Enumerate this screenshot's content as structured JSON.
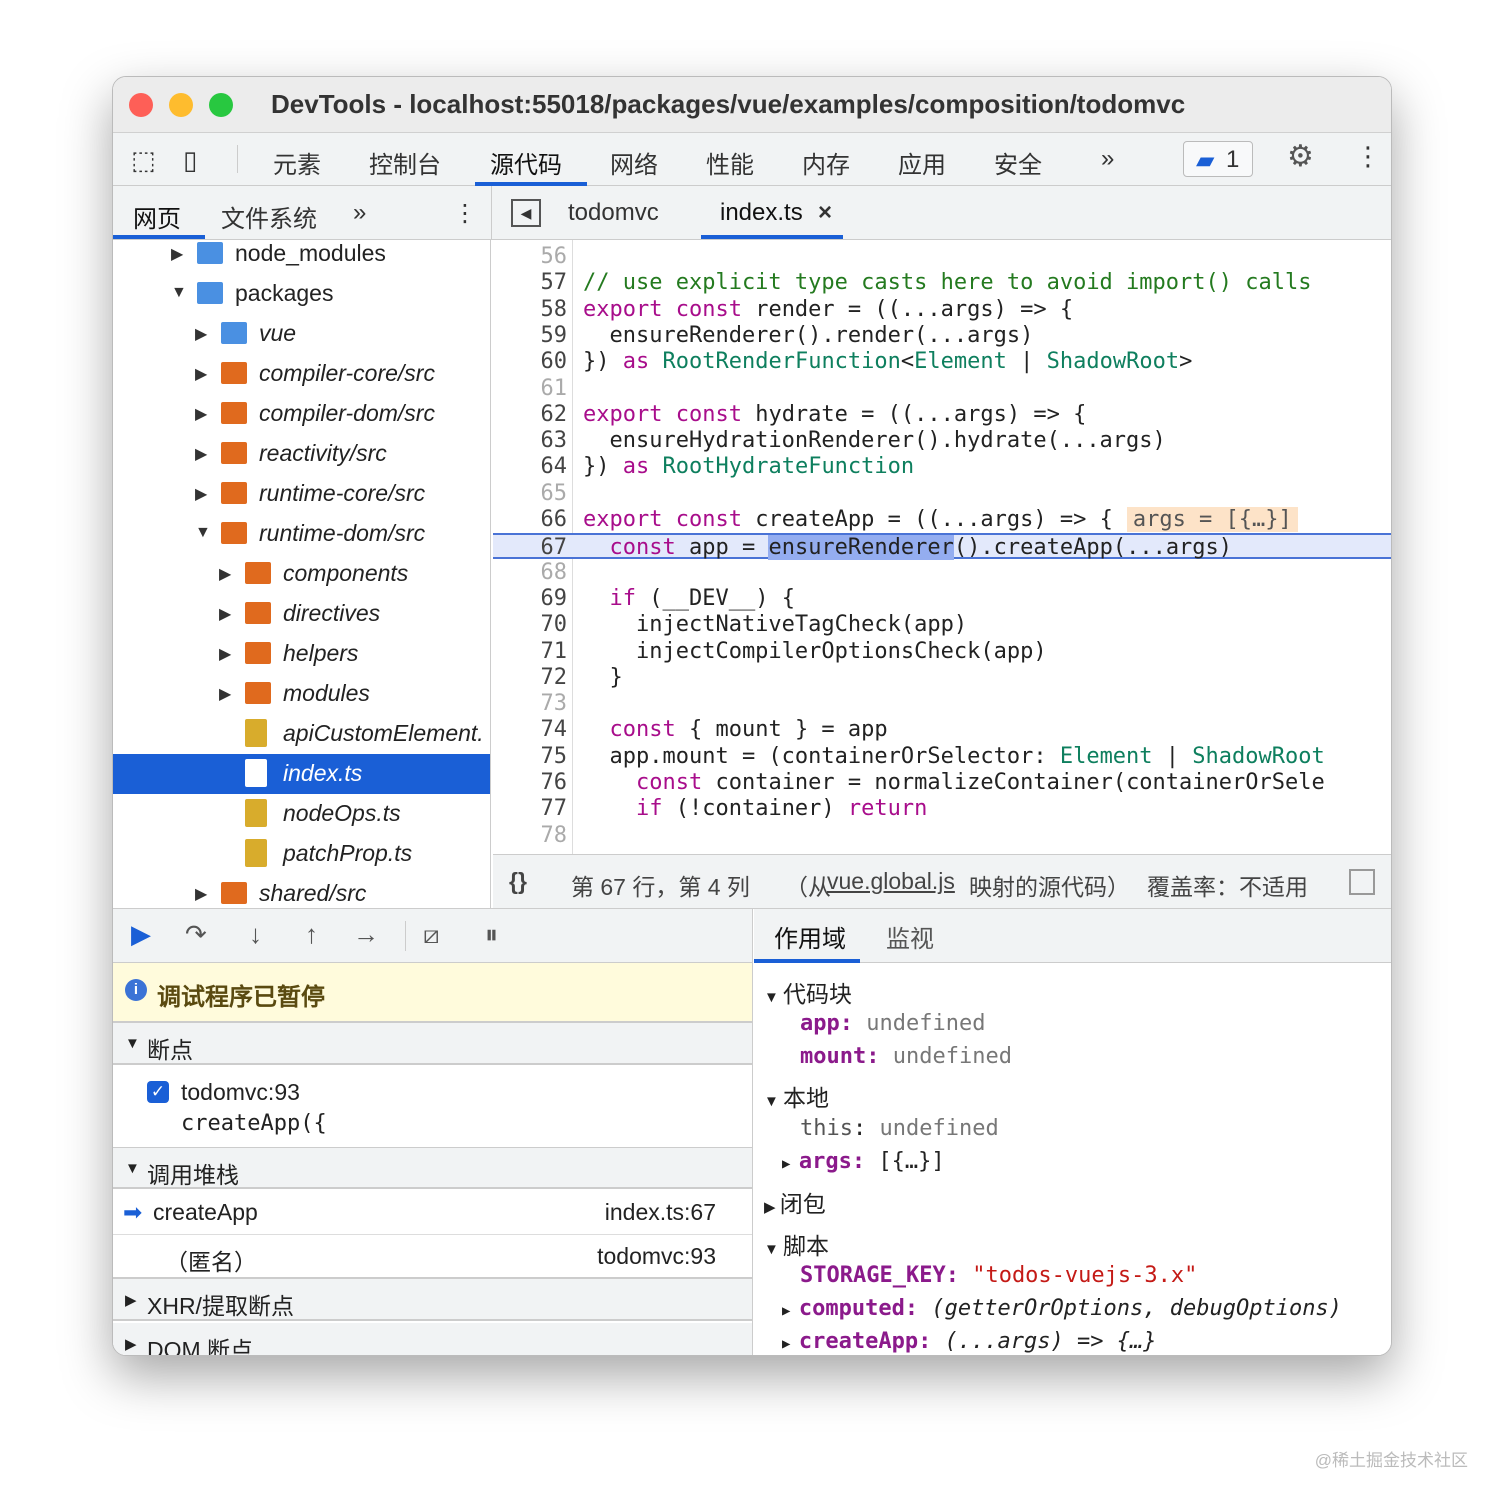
{
  "window": {
    "title": "DevTools - localhost:55018/packages/vue/examples/composition/todomvc"
  },
  "toolbar": {
    "tabs": [
      "元素",
      "控制台",
      "源代码",
      "网络",
      "性能",
      "内存",
      "应用",
      "安全"
    ],
    "active": "源代码",
    "more": "»",
    "issues_count": "1"
  },
  "navigator": {
    "tabs": [
      "网页",
      "文件系统"
    ],
    "more": "»",
    "active": "网页"
  },
  "editor_tabs": {
    "tabs": [
      "todomvc",
      "index.ts"
    ],
    "active": "index.ts",
    "close": "×"
  },
  "tree": [
    {
      "label": "node_modules",
      "depth": 0,
      "open": false,
      "type": "folder-blue"
    },
    {
      "label": "packages",
      "depth": 0,
      "open": true,
      "type": "folder-blue"
    },
    {
      "label": "vue",
      "depth": 1,
      "open": false,
      "type": "folder-blue"
    },
    {
      "label": "compiler-core/src",
      "depth": 1,
      "open": false,
      "type": "folder-orange"
    },
    {
      "label": "compiler-dom/src",
      "depth": 1,
      "open": false,
      "type": "folder-orange"
    },
    {
      "label": "reactivity/src",
      "depth": 1,
      "open": false,
      "type": "folder-orange"
    },
    {
      "label": "runtime-core/src",
      "depth": 1,
      "open": false,
      "type": "folder-orange"
    },
    {
      "label": "runtime-dom/src",
      "depth": 1,
      "open": true,
      "type": "folder-orange"
    },
    {
      "label": "components",
      "depth": 2,
      "open": false,
      "type": "folder-orange"
    },
    {
      "label": "directives",
      "depth": 2,
      "open": false,
      "type": "folder-orange"
    },
    {
      "label": "helpers",
      "depth": 2,
      "open": false,
      "type": "folder-orange"
    },
    {
      "label": "modules",
      "depth": 2,
      "open": false,
      "type": "folder-orange"
    },
    {
      "label": "apiCustomElement.",
      "depth": 2,
      "type": "file"
    },
    {
      "label": "index.ts",
      "depth": 2,
      "type": "file",
      "selected": true
    },
    {
      "label": "nodeOps.ts",
      "depth": 2,
      "type": "file"
    },
    {
      "label": "patchProp.ts",
      "depth": 2,
      "type": "file"
    },
    {
      "label": "shared/src",
      "depth": 1,
      "open": false,
      "type": "folder-orange"
    }
  ],
  "code": [
    {
      "n": "56",
      "t": []
    },
    {
      "n": "57",
      "t": [
        [
          "// use explicit type casts here to avoid import() calls",
          "cm"
        ]
      ]
    },
    {
      "n": "58",
      "t": [
        [
          "export const",
          "kw"
        ],
        [
          " render = ((...args) => {",
          ""
        ]
      ]
    },
    {
      "n": "59",
      "t": [
        [
          "  ensureRenderer().render(...args)",
          ""
        ]
      ]
    },
    {
      "n": "60",
      "t": [
        [
          "}) ",
          ""
        ],
        [
          "as",
          "kw"
        ],
        [
          " ",
          ""
        ],
        [
          "RootRenderFunction",
          "ty"
        ],
        [
          "<",
          ""
        ],
        [
          "Element",
          "ty"
        ],
        [
          " | ",
          ""
        ],
        [
          "ShadowRoot",
          "ty"
        ],
        [
          ">",
          ""
        ]
      ]
    },
    {
      "n": "61",
      "t": []
    },
    {
      "n": "62",
      "t": [
        [
          "export const",
          "kw"
        ],
        [
          " hydrate = ((...args) => {",
          ""
        ]
      ]
    },
    {
      "n": "63",
      "t": [
        [
          "  ensureHydrationRenderer().hydrate(...args)",
          ""
        ]
      ]
    },
    {
      "n": "64",
      "t": [
        [
          "}) ",
          ""
        ],
        [
          "as",
          "kw"
        ],
        [
          " ",
          ""
        ],
        [
          "RootHydrateFunction",
          "ty"
        ]
      ]
    },
    {
      "n": "65",
      "t": []
    },
    {
      "n": "66",
      "t": [
        [
          "export const",
          "kw"
        ],
        [
          " createApp = ((...args) => {",
          ""
        ],
        [
          "args = [{…}]",
          "inl"
        ]
      ]
    },
    {
      "n": "67",
      "t": [
        [
          "  ",
          ""
        ],
        [
          "const",
          "kw"
        ],
        [
          " app = ",
          ""
        ],
        [
          "ensureRenderer",
          "hl"
        ],
        [
          "().createApp(...args)",
          ""
        ]
      ],
      "current": true
    },
    {
      "n": "68",
      "t": []
    },
    {
      "n": "69",
      "t": [
        [
          "  ",
          ""
        ],
        [
          "if",
          "kw"
        ],
        [
          " (__DEV__) {",
          ""
        ]
      ]
    },
    {
      "n": "70",
      "t": [
        [
          "    injectNativeTagCheck(app)",
          ""
        ]
      ]
    },
    {
      "n": "71",
      "t": [
        [
          "    injectCompilerOptionsCheck(app)",
          ""
        ]
      ]
    },
    {
      "n": "72",
      "t": [
        [
          "  }",
          ""
        ]
      ]
    },
    {
      "n": "73",
      "t": []
    },
    {
      "n": "74",
      "t": [
        [
          "  ",
          ""
        ],
        [
          "const",
          "kw"
        ],
        [
          " { mount } = app",
          ""
        ]
      ]
    },
    {
      "n": "75",
      "t": [
        [
          "  app.mount = (containerOrSelector: ",
          ""
        ],
        [
          "Element",
          "ty"
        ],
        [
          " | ",
          ""
        ],
        [
          "ShadowRoot",
          "ty"
        ]
      ]
    },
    {
      "n": "76",
      "t": [
        [
          "    ",
          ""
        ],
        [
          "const",
          "kw"
        ],
        [
          " container = normalizeContainer(containerOrSele",
          ""
        ]
      ]
    },
    {
      "n": "77",
      "t": [
        [
          "    ",
          ""
        ],
        [
          "if",
          "kw"
        ],
        [
          " (!container) ",
          ""
        ],
        [
          "return",
          "kw"
        ]
      ]
    },
    {
      "n": "78",
      "t": []
    }
  ],
  "status": {
    "braces": "{}",
    "position": "第 67 行，第 4 列",
    "source_prefix": "（从",
    "source_link": "vue.global.js",
    "source_suffix": "映射的源代码）",
    "coverage": "覆盖率：不适用"
  },
  "debugger": {
    "paused_message": "调试程序已暂停",
    "breakpoints_title": "断点",
    "breakpoint": {
      "location": "todomvc:93",
      "code": "createApp({",
      "checked": true
    },
    "callstack_title": "调用堆栈",
    "frames": [
      {
        "name": "createApp",
        "loc": "index.ts:67",
        "current": true
      },
      {
        "name": "（匿名）",
        "loc": "todomvc:93"
      }
    ],
    "xhr_title": "XHR/提取断点",
    "dom_title": "DOM 断点"
  },
  "scope": {
    "tabs": [
      "作用域",
      "监视"
    ],
    "active": "作用域",
    "block_title": "代码块",
    "block": [
      {
        "k": "app",
        "v": "undefined"
      },
      {
        "k": "mount",
        "v": "undefined"
      }
    ],
    "local_title": "本地",
    "local_this_k": "this",
    "local_this_v": "undefined",
    "local_args_k": "args",
    "local_args_v": "[{…}]",
    "closure_title": "闭包",
    "script_title": "脚本",
    "script": [
      {
        "k": "STORAGE_KEY",
        "v": "\"todos-vuejs-3.x\""
      },
      {
        "k": "computed",
        "v": "(getterOrOptions, debugOptions)"
      },
      {
        "k": "createApp",
        "v": "(...args) => {…}"
      }
    ]
  },
  "watermark": "@稀土掘金技术社区",
  "colors": {
    "accent": "#1a5fd6",
    "keyword": "#a80d8b",
    "comment": "#247a1f",
    "type": "#0e7f5e",
    "paused_bg": "#fffbdc"
  }
}
